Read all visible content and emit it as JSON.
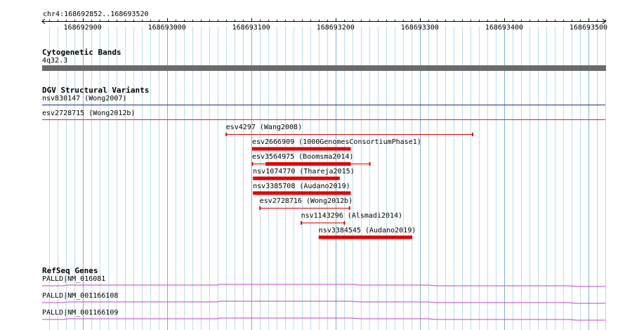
{
  "location": "chr4:168692852..168693520",
  "view": {
    "start": 168692852,
    "end": 168693520
  },
  "ruler": {
    "ticks": [
      168692900,
      168693000,
      168693100,
      168693200,
      168693300,
      168693400,
      168693500
    ]
  },
  "tracks": {
    "cytoband": {
      "title": "Cytogenetic Bands",
      "band": "4q32.3",
      "color": "#6b6b6b"
    },
    "dgv": {
      "title": "DGV Structural Variants",
      "full_span": [
        {
          "label": "nsv830147 (Wong2007)",
          "color": "#1f2d8c"
        },
        {
          "label": "esv2728715 (Wong2012b)",
          "color": "#e02020"
        }
      ],
      "features": [
        {
          "label": "esv4297 (Wang2008)",
          "start": 168693070,
          "end": 168693363,
          "style": "line"
        },
        {
          "label": "esv2666909 (1000GenomesConsortiumPhase1)",
          "start": 168693101,
          "end": 168693218,
          "style": "bar"
        },
        {
          "label": "esv3564975 (Boomsma2014)",
          "start": 168693101,
          "end": 168693241,
          "style": "mixed",
          "solid_start": 168693117,
          "solid_end": 168693218
        },
        {
          "label": "nsv1074770 (Thareja2015)",
          "start": 168693102,
          "end": 168693205,
          "style": "bar"
        },
        {
          "label": "nsv3385708 (Audano2019)",
          "start": 168693102,
          "end": 168693218,
          "style": "bar"
        },
        {
          "label": "esv2728716 (Wong2012b)",
          "start": 168693110,
          "end": 168693217,
          "style": "line"
        },
        {
          "label": "nsv1143296 (Alsmadi2014)",
          "start": 168693159,
          "end": 168693211,
          "style": "line"
        },
        {
          "label": "nsv3384545 (Audano2019)",
          "start": 168693180,
          "end": 168693291,
          "style": "bar"
        }
      ],
      "color": "#e00000"
    },
    "refseq": {
      "title": "RefSeq Genes",
      "genes": [
        {
          "label": "PALLD|NM_016081"
        },
        {
          "label": "PALLD|NM_001166108"
        },
        {
          "label": "PALLD|NM_001166109"
        }
      ],
      "color": "#c040c8"
    }
  }
}
